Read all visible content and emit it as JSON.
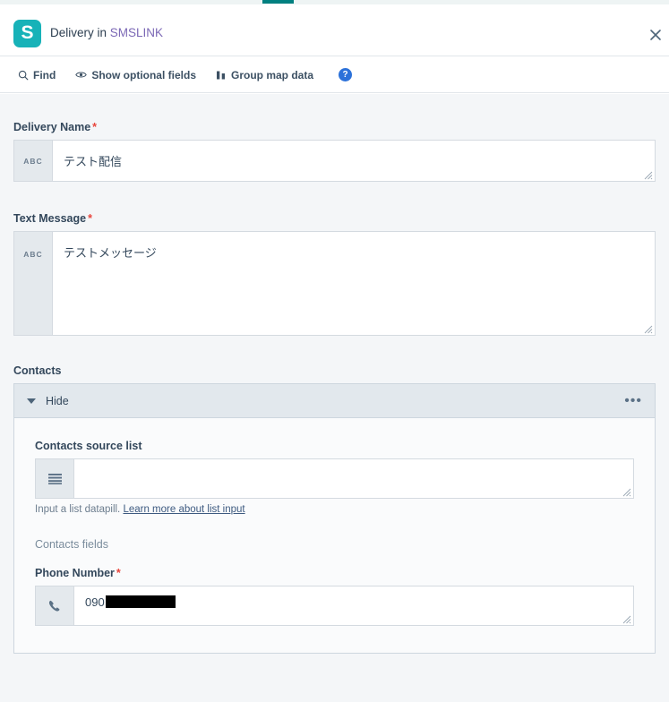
{
  "window": {
    "logo_letter": "S",
    "title_prefix": "Delivery in ",
    "title_brand": "SMSLINK",
    "close_label": "✕",
    "logo_color": "#17b2b8",
    "brand_color": "#7b68b5",
    "tab_indicator_color": "#008080"
  },
  "toolbar": {
    "find_label": "Find",
    "show_optional_label": "Show optional fields",
    "group_map_label": "Group map data",
    "help_label": "?",
    "help_color": "#2c71d9"
  },
  "fields": {
    "delivery_name": {
      "label": "Delivery Name",
      "required": "*",
      "prefix": "ABC",
      "value": "テスト配信"
    },
    "text_message": {
      "label": "Text Message",
      "required": "*",
      "prefix": "ABC",
      "value": "テストメッセージ"
    }
  },
  "contacts": {
    "label": "Contacts",
    "panel_toggle_label": "Hide",
    "menu_label": "•••",
    "source_list": {
      "label": "Contacts source list",
      "value": "",
      "placeholder": "",
      "hint_text": "Input a list datapill. ",
      "hint_link": "Learn more about list input"
    },
    "fields_label": "Contacts fields",
    "phone_number": {
      "label": "Phone Number",
      "required": "*",
      "value": "090",
      "redacted": true
    }
  }
}
